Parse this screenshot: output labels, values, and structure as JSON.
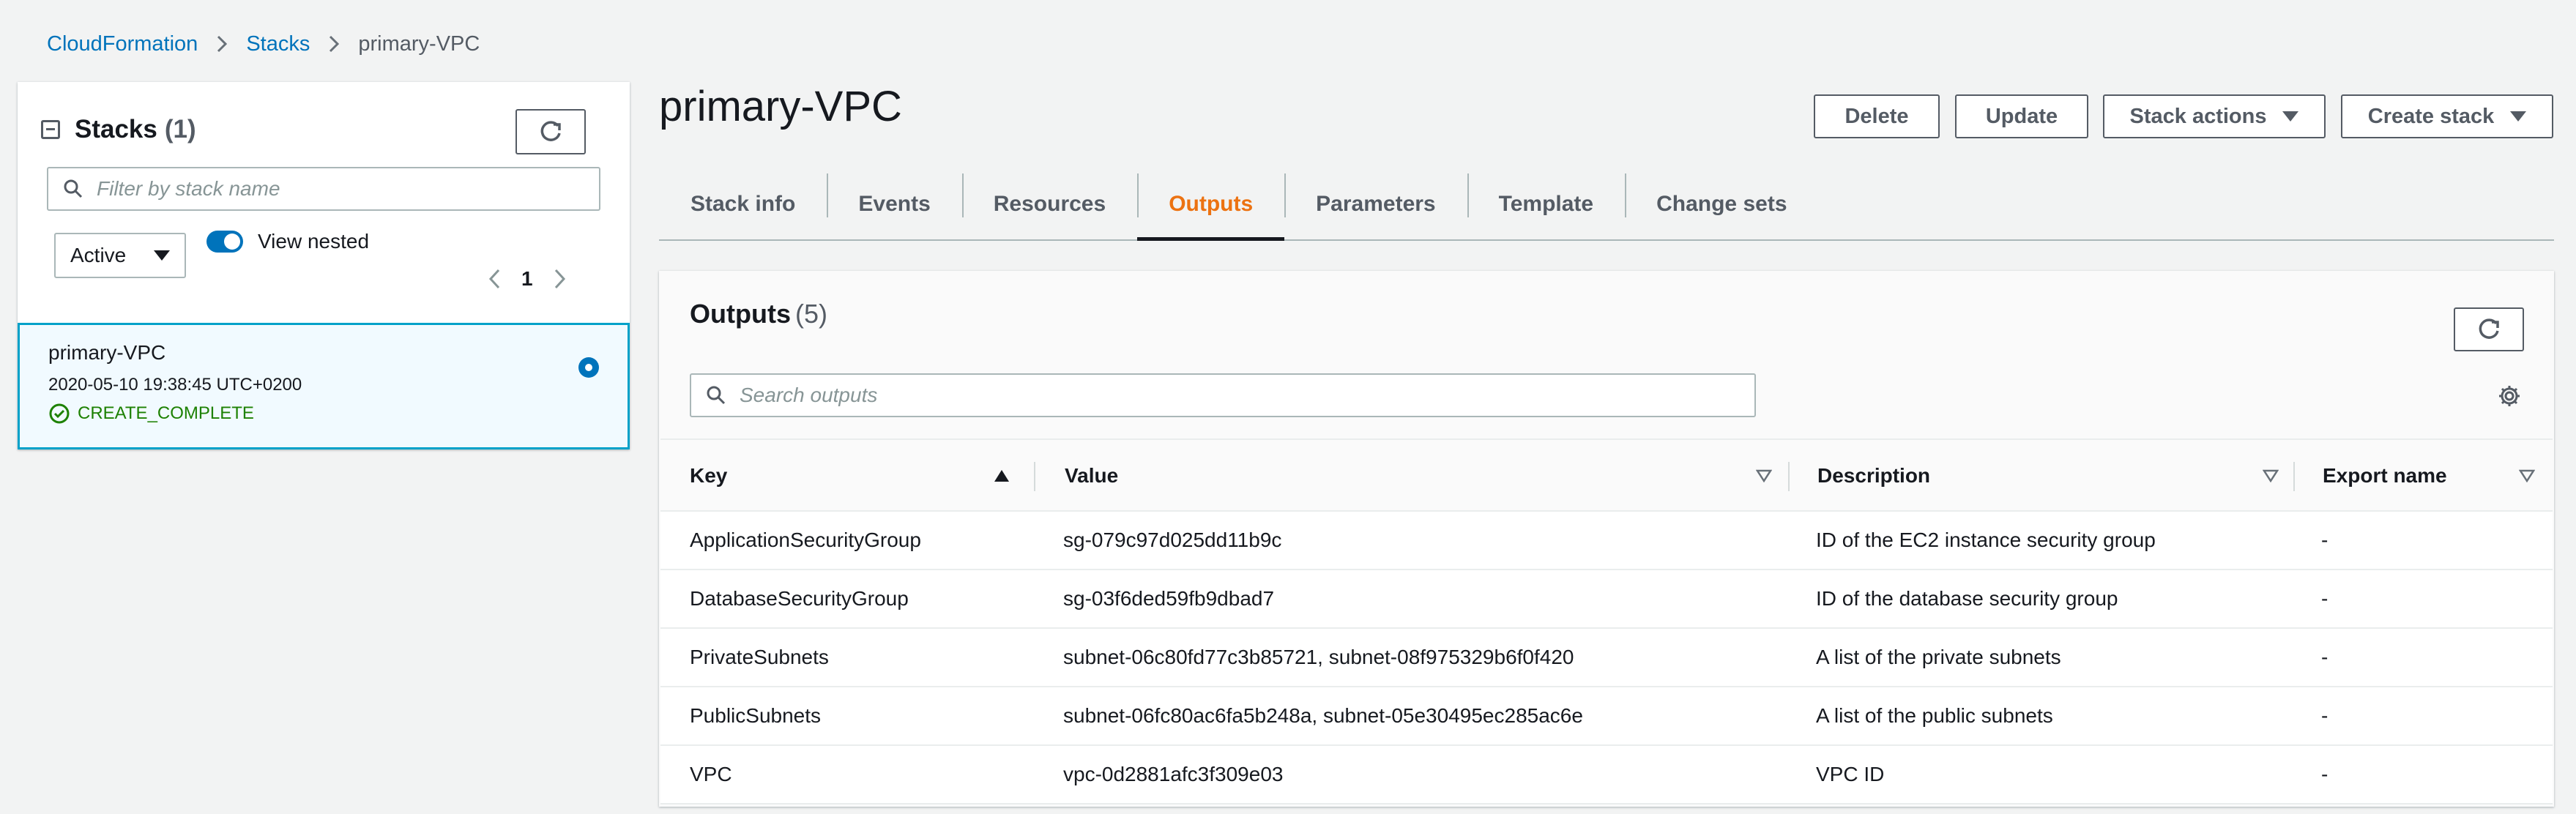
{
  "breadcrumb": {
    "items": [
      "CloudFormation",
      "Stacks"
    ],
    "current": "primary-VPC"
  },
  "sidebar": {
    "title": "Stacks",
    "count": "(1)",
    "search_placeholder": "Filter by stack name",
    "filter_value": "Active",
    "view_nested_label": "View nested",
    "view_nested_on": true,
    "page": "1",
    "stacks": [
      {
        "name": "primary-VPC",
        "created": "2020-05-10 19:38:45 UTC+0200",
        "status": "CREATE_COMPLETE",
        "selected": true
      }
    ]
  },
  "main": {
    "title": "primary-VPC",
    "actions": {
      "delete": "Delete",
      "update": "Update",
      "stack_actions": "Stack actions",
      "create_stack": "Create stack"
    },
    "tabs": [
      {
        "label": "Stack info",
        "active": false
      },
      {
        "label": "Events",
        "active": false
      },
      {
        "label": "Resources",
        "active": false
      },
      {
        "label": "Outputs",
        "active": true
      },
      {
        "label": "Parameters",
        "active": false
      },
      {
        "label": "Template",
        "active": false
      },
      {
        "label": "Change sets",
        "active": false
      }
    ]
  },
  "outputs": {
    "title": "Outputs",
    "count": "(5)",
    "search_placeholder": "Search outputs",
    "columns": [
      "Key",
      "Value",
      "Description",
      "Export name"
    ],
    "rows": [
      {
        "key": "ApplicationSecurityGroup",
        "value": "sg-079c97d025dd11b9c",
        "description": "ID of the EC2 instance security group",
        "export": "-"
      },
      {
        "key": "DatabaseSecurityGroup",
        "value": "sg-03f6ded59fb9dbad7",
        "description": "ID of the database security group",
        "export": "-"
      },
      {
        "key": "PrivateSubnets",
        "value": "subnet-06c80fd77c3b85721, subnet-08f975329b6f0f420",
        "description": "A list of the private subnets",
        "export": "-"
      },
      {
        "key": "PublicSubnets",
        "value": "subnet-06fc80ac6fa5b248a, subnet-05e30495ec285ac6e",
        "description": "A list of the public subnets",
        "export": "-"
      },
      {
        "key": "VPC",
        "value": "vpc-0d2881afc3f309e03",
        "description": "VPC ID",
        "export": "-"
      }
    ]
  },
  "colors": {
    "link": "#0073bb",
    "active_tab": "#ec7211",
    "success": "#1d8102",
    "selected_border": "#00a1c9",
    "selected_bg": "#f1faff"
  }
}
